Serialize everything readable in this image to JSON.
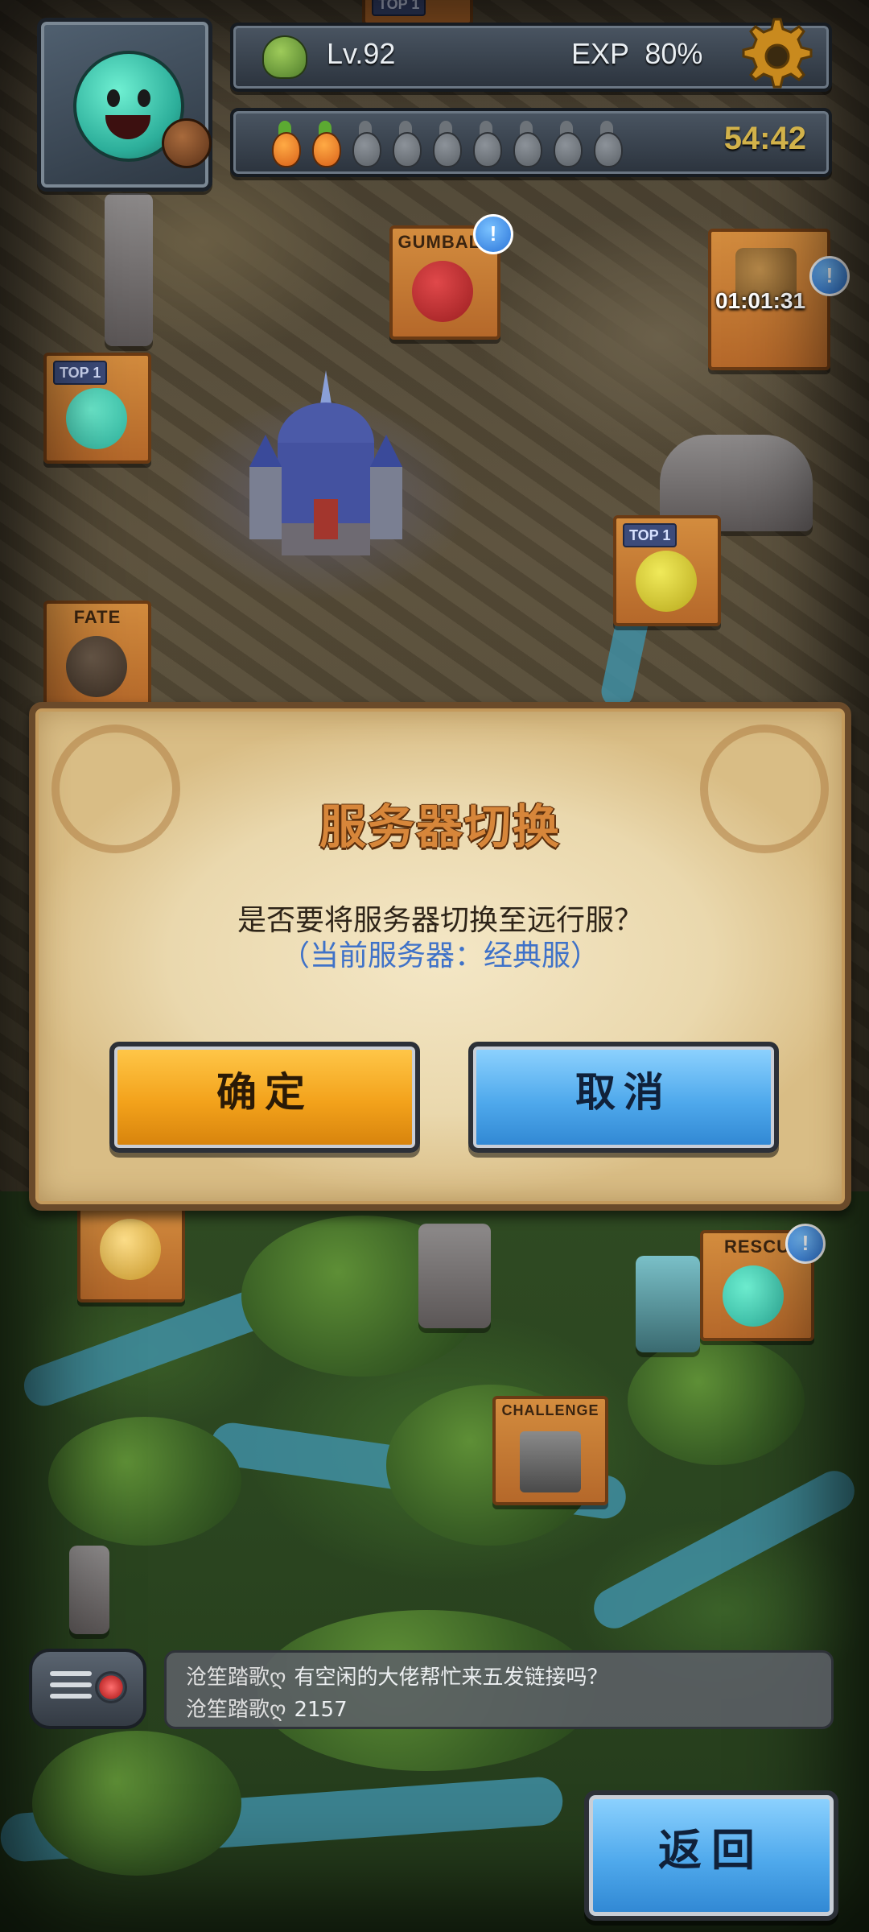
{
  "hud": {
    "level": "Lv.92",
    "exp": "EXP  80%",
    "stamina_full": 2,
    "stamina_total": 10,
    "stamina_timer": "54:42"
  },
  "map": {
    "signs": [
      {
        "id": "gumball",
        "label": "GUMBALL"
      },
      {
        "id": "top1-left",
        "tag": "TOP 1"
      },
      {
        "id": "top1-right",
        "tag": "TOP 1"
      },
      {
        "id": "fate",
        "label": "FATE"
      },
      {
        "id": "rescue",
        "label": "RESCU"
      },
      {
        "id": "challenge",
        "label": "CHALLENGE"
      }
    ],
    "chest_timer": "01:01:31",
    "top_partial_tag": "TOP 1"
  },
  "dialog": {
    "title": "服务器切换",
    "message": "是否要将服务器切换至远行服？",
    "sub": "（当前服务器：经典服）",
    "confirm_label": "确定",
    "cancel_label": "取消"
  },
  "chat": {
    "messages": [
      {
        "user": "沧笙踏歌ღ",
        "text": "有空闲的大佬帮忙来五发链接吗？"
      },
      {
        "user": "沧笙踏歌ღ",
        "text": "2157"
      }
    ]
  },
  "back_label": "返回",
  "colors": {
    "confirm": "#f3a21b",
    "cancel": "#4fa9ec",
    "title": "#d7863a",
    "sub_text": "#3f72c8"
  }
}
